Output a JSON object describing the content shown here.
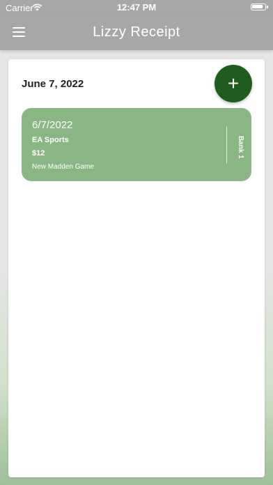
{
  "status_bar": {
    "carrier": "Carrier",
    "time": "12:47 PM",
    "battery_level": 0.9
  },
  "header": {
    "title": "Lizzy Receipt"
  },
  "main": {
    "date_heading": "June 7, 2022",
    "add_button_label": "+",
    "receipts": [
      {
        "date": "6/7/2022",
        "vendor": "EA Sports",
        "amount": "$12",
        "description": "New Madden Game",
        "bank": "Bank 1"
      }
    ]
  },
  "colors": {
    "accent": "#1f5c1f",
    "card": "#8ab584",
    "navbar": "#a7a7a7"
  }
}
